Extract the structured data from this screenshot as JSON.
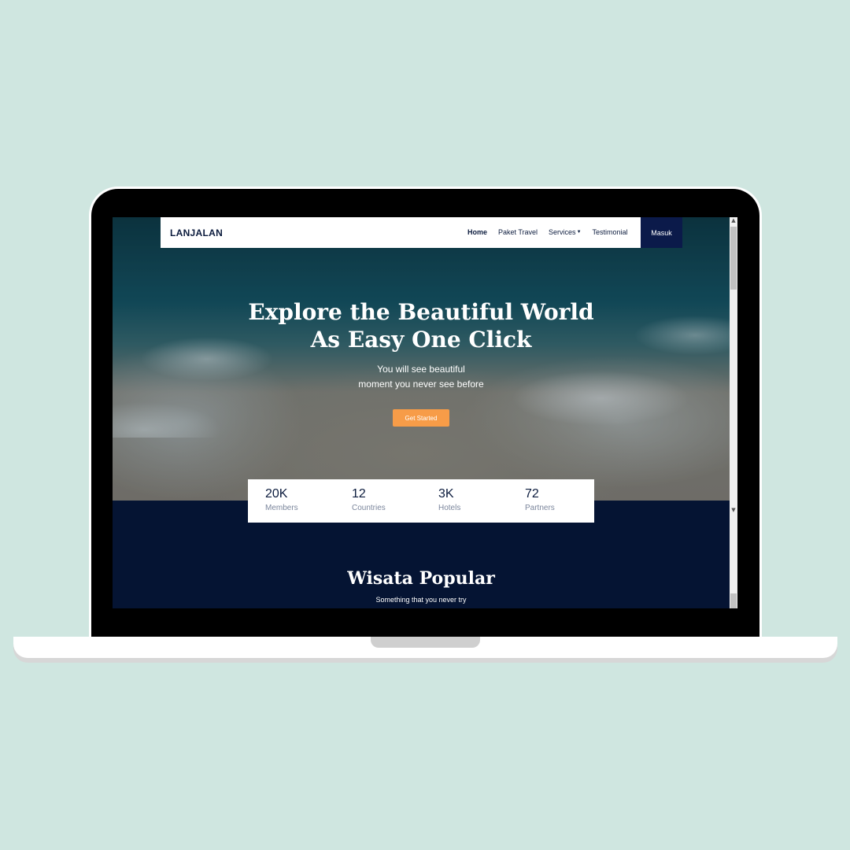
{
  "navbar": {
    "logo": "LANJALAN",
    "links": [
      {
        "label": "Home",
        "active": true
      },
      {
        "label": "Paket Travel",
        "active": false
      },
      {
        "label": "Services",
        "active": false,
        "dropdown": true
      },
      {
        "label": "Testimonial",
        "active": false
      }
    ],
    "login_label": "Masuk"
  },
  "hero": {
    "title_line1": "Explore the Beautiful World",
    "title_line2": "As Easy One Click",
    "subtitle_line1": "You will see beautiful",
    "subtitle_line2": "moment you never see before",
    "cta_label": "Get Started"
  },
  "stats": [
    {
      "value": "20K",
      "label": "Members"
    },
    {
      "value": "12",
      "label": "Countries"
    },
    {
      "value": "3K",
      "label": "Hotels"
    },
    {
      "value": "72",
      "label": "Partners"
    }
  ],
  "section": {
    "title": "Wisata Popular",
    "subtitle": "Something that you never try"
  },
  "icons": {
    "caret": "caret-down-icon",
    "scroll_up": "chevron-up-icon",
    "scroll_down": "chevron-down-icon"
  },
  "colors": {
    "navy": "#051433",
    "accent": "#f79c48",
    "login_button": "#0b1a4a",
    "background": "#cfe6e0"
  }
}
